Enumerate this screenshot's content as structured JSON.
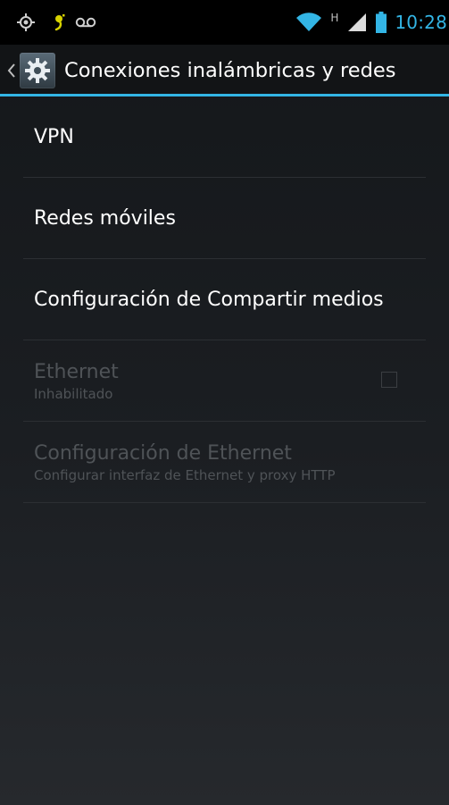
{
  "status_bar": {
    "time": "10:28",
    "network_type": "H",
    "icons": [
      "gps-icon",
      "usb-debug-icon",
      "voicemail-icon",
      "wifi-icon",
      "signal-icon",
      "battery-icon"
    ]
  },
  "action_bar": {
    "title": "Conexiones inalámbricas y redes",
    "icon": "settings-gear-icon"
  },
  "colors": {
    "accent": "#33b5e5",
    "disabled_text": "#4f5357"
  },
  "list": {
    "items": [
      {
        "title": "VPN",
        "enabled": true
      },
      {
        "title": "Redes móviles",
        "enabled": true
      },
      {
        "title": "Configuración de Compartir medios",
        "enabled": true
      },
      {
        "title": "Ethernet",
        "summary": "Inhabilitado",
        "enabled": false,
        "checkbox": false
      },
      {
        "title": "Configuración de Ethernet",
        "summary": "Configurar interfaz de Ethernet y proxy HTTP",
        "enabled": false
      }
    ]
  }
}
